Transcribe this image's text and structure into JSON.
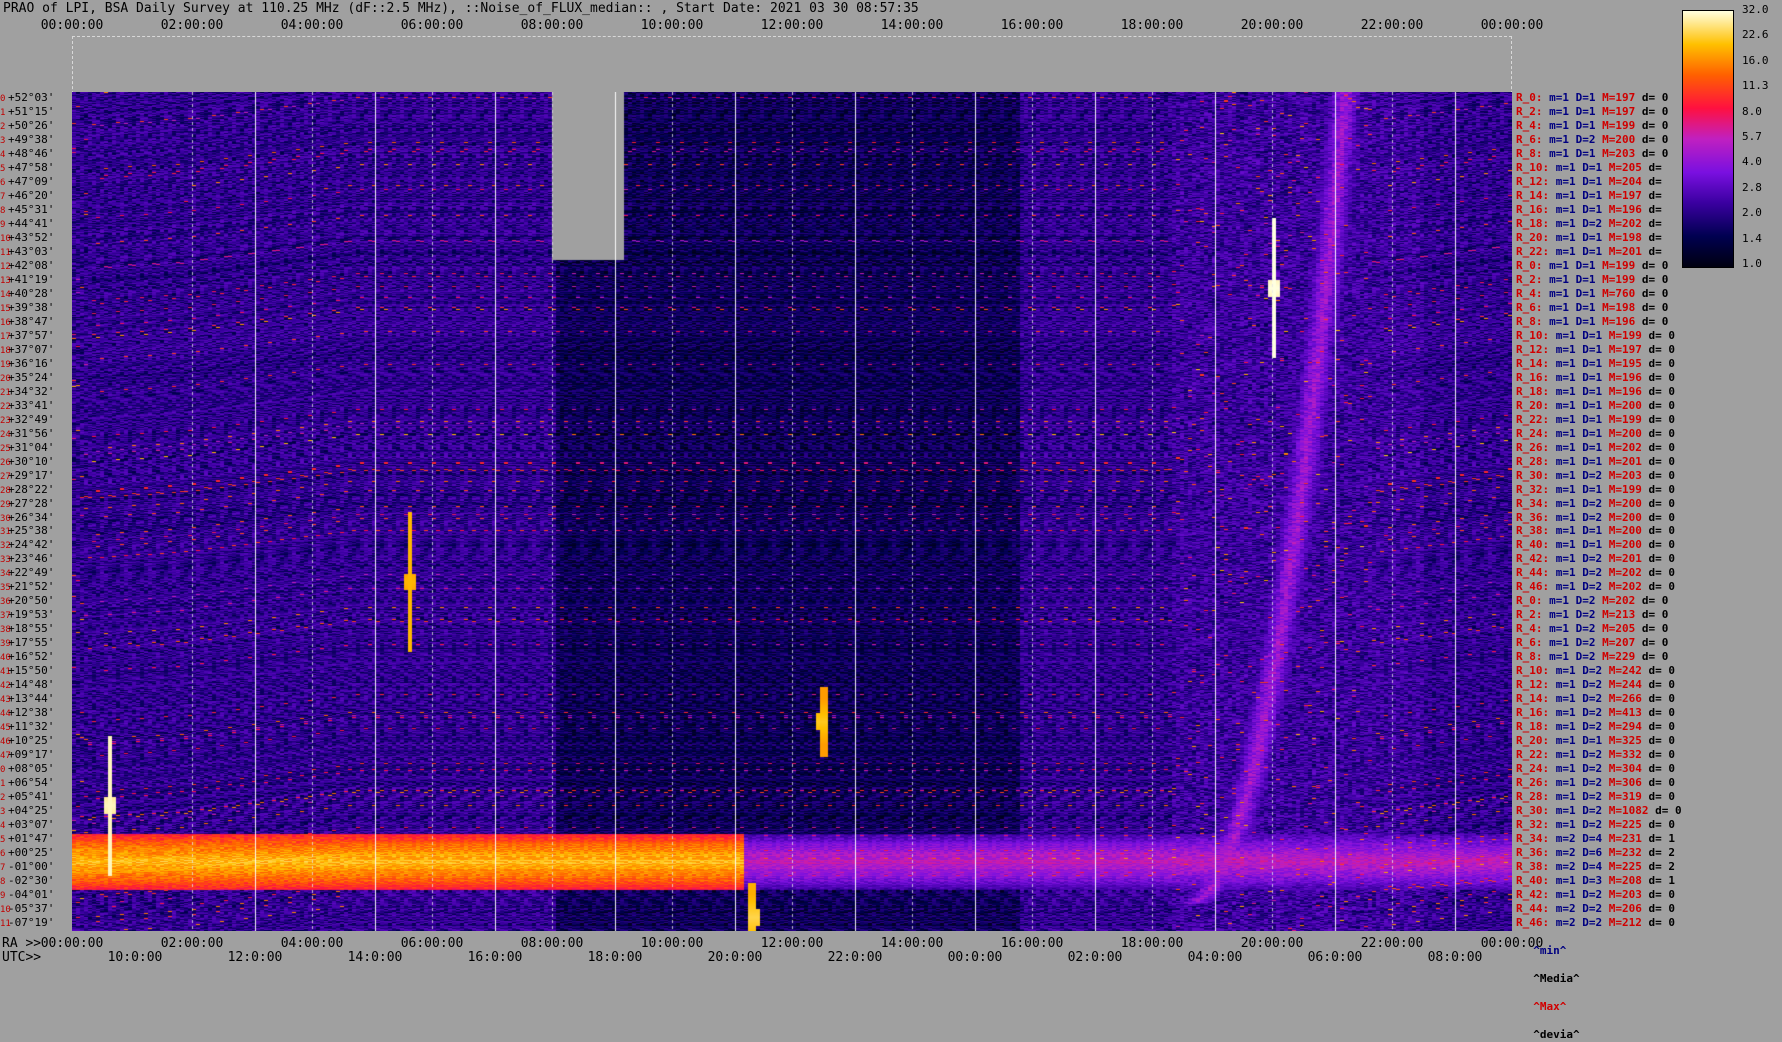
{
  "title": "PRAO of LPI, BSA Daily Survey at 110.25 MHz (dF::2.5 MHz), ::Noise_of_FLUX_median:: , Start Date: 2021 03 30 08:57:35",
  "axes": {
    "top_ticks": [
      "00:00:00",
      "02:00:00",
      "04:00:00",
      "06:00:00",
      "08:00:00",
      "10:00:00",
      "12:00:00",
      "14:00:00",
      "16:00:00",
      "18:00:00",
      "20:00:00",
      "22:00:00",
      "00:00:00"
    ],
    "ra_prefix": "RA >>",
    "ra_ticks": [
      "00:00:00",
      "02:00:00",
      "04:00:00",
      "06:00:00",
      "08:00:00",
      "10:00:00",
      "12:00:00",
      "14:00:00",
      "16:00:00",
      "18:00:00",
      "20:00:00",
      "22:00:00",
      "00:00:00"
    ],
    "utc_prefix": "UTC>>",
    "utc_ticks": [
      "10:0:00",
      "12:0:00",
      "14:0:00",
      "16:0:00",
      "18:0:00",
      "20:0:00",
      "22:0:00",
      "00:0:00",
      "02:0:00",
      "04:0:00",
      "06:0:00",
      "08:0:00"
    ]
  },
  "colorbar": {
    "labels": [
      "32.0",
      "22.6",
      "16.0",
      "11.3",
      "8.0",
      "5.7",
      "4.0",
      "2.8",
      "2.0",
      "1.4",
      "1.0"
    ],
    "colors": [
      "#000010",
      "#000050",
      "#3a00a0",
      "#7a10e0",
      "#c020c0",
      "#ff1040",
      "#ff6000",
      "#ffc000",
      "#ffffe0"
    ]
  },
  "chart_data": {
    "type": "heatmap",
    "title": "PRAO of LPI, BSA Daily Survey at 110.25 MHz (dF::2.5 MHz), ::Noise_of_FLUX_median:: , Start Date: 2021 03 30 08:57:35",
    "x_range_hours": [
      0,
      24
    ],
    "color_scale": [
      1.0,
      32.0
    ],
    "declinations": [
      "+52°03'",
      "+51°15'",
      "+50°26'",
      "+49°38'",
      "+48°46'",
      "+47°58'",
      "+47°09'",
      "+46°20'",
      "+45°31'",
      "+44°41'",
      "+43°52'",
      "+43°03'",
      "+42°08'",
      "+41°19'",
      "+40°28'",
      "+39°38'",
      "+38°47'",
      "+37°57'",
      "+37°07'",
      "+36°16'",
      "+35°24'",
      "+34°32'",
      "+33°41'",
      "+32°49'",
      "+31°56'",
      "+31°04'",
      "+30°10'",
      "+29°17'",
      "+28°22'",
      "+27°28'",
      "+26°34'",
      "+25°38'",
      "+24°42'",
      "+23°46'",
      "+22°49'",
      "+21°52'",
      "+20°50'",
      "+19°53'",
      "+18°55'",
      "+17°55'",
      "+16°52'",
      "+15°50'",
      "+14°48'",
      "+13°44'",
      "+12°38'",
      "+11°32'",
      "+10°25'",
      "+09°17'",
      "+08°05'",
      "+06°54'",
      "+05°41'",
      "+04°25'",
      "+03°07'",
      "+01°47'",
      "+00°25'",
      "-01°00'",
      "-02°30'",
      "-04°01'",
      "-05°37'",
      "-07°19'"
    ],
    "row_index": [
      "0",
      "1",
      "2",
      "3",
      "4",
      "5",
      "6",
      "7",
      "8",
      "9",
      "10",
      "11",
      "12",
      "13",
      "14",
      "15",
      "16",
      "17",
      "18",
      "19",
      "20",
      "21",
      "22",
      "23",
      "24",
      "25",
      "26",
      "27",
      "28",
      "29",
      "30",
      "31",
      "32",
      "33",
      "34",
      "35",
      "36",
      "37",
      "38",
      "39",
      "40",
      "41",
      "42",
      "43",
      "44",
      "45",
      "46",
      "47",
      "0",
      "1",
      "2",
      "3",
      "4",
      "5",
      "6",
      "7",
      "8",
      "9",
      "10",
      "11"
    ],
    "row_stats": [
      {
        "r": "R_0:",
        "m": "m=1",
        "d": "D=1",
        "mx": "M=197",
        "dv": "d= 0"
      },
      {
        "r": "R_2:",
        "m": "m=1",
        "d": "D=1",
        "mx": "M=197",
        "dv": "d= 0"
      },
      {
        "r": "R_4:",
        "m": "m=1",
        "d": "D=1",
        "mx": "M=199",
        "dv": "d= 0"
      },
      {
        "r": "R_6:",
        "m": "m=1",
        "d": "D=2",
        "mx": "M=200",
        "dv": "d= 0"
      },
      {
        "r": "R_8:",
        "m": "m=1",
        "d": "D=1",
        "mx": "M=203",
        "dv": "d= 0"
      },
      {
        "r": "R_10:",
        "m": "m=1",
        "d": "D=1",
        "mx": "M=205",
        "dv": "d="
      },
      {
        "r": "R_12:",
        "m": "m=1",
        "d": "D=1",
        "mx": "M=204",
        "dv": "d="
      },
      {
        "r": "R_14:",
        "m": "m=1",
        "d": "D=1",
        "mx": "M=197",
        "dv": "d="
      },
      {
        "r": "R_16:",
        "m": "m=1",
        "d": "D=1",
        "mx": "M=196",
        "dv": "d="
      },
      {
        "r": "R_18:",
        "m": "m=1",
        "d": "D=2",
        "mx": "M=202",
        "dv": "d="
      },
      {
        "r": "R_20:",
        "m": "m=1",
        "d": "D=1",
        "mx": "M=198",
        "dv": "d="
      },
      {
        "r": "R_22:",
        "m": "m=1",
        "d": "D=1",
        "mx": "M=201",
        "dv": "d="
      },
      {
        "r": "R_0:",
        "m": "m=1",
        "d": "D=1",
        "mx": "M=199",
        "dv": "d= 0"
      },
      {
        "r": "R_2:",
        "m": "m=1",
        "d": "D=1",
        "mx": "M=199",
        "dv": "d= 0"
      },
      {
        "r": "R_4:",
        "m": "m=1",
        "d": "D=1",
        "mx": "M=760",
        "dv": "d= 0"
      },
      {
        "r": "R_6:",
        "m": "m=1",
        "d": "D=1",
        "mx": "M=198",
        "dv": "d= 0"
      },
      {
        "r": "R_8:",
        "m": "m=1",
        "d": "D=1",
        "mx": "M=196",
        "dv": "d= 0"
      },
      {
        "r": "R_10:",
        "m": "m=1",
        "d": "D=1",
        "mx": "M=199",
        "dv": "d= 0"
      },
      {
        "r": "R_12:",
        "m": "m=1",
        "d": "D=1",
        "mx": "M=197",
        "dv": "d= 0"
      },
      {
        "r": "R_14:",
        "m": "m=1",
        "d": "D=1",
        "mx": "M=195",
        "dv": "d= 0"
      },
      {
        "r": "R_16:",
        "m": "m=1",
        "d": "D=1",
        "mx": "M=196",
        "dv": "d= 0"
      },
      {
        "r": "R_18:",
        "m": "m=1",
        "d": "D=1",
        "mx": "M=196",
        "dv": "d= 0"
      },
      {
        "r": "R_20:",
        "m": "m=1",
        "d": "D=1",
        "mx": "M=200",
        "dv": "d= 0"
      },
      {
        "r": "R_22:",
        "m": "m=1",
        "d": "D=1",
        "mx": "M=199",
        "dv": "d= 0"
      },
      {
        "r": "R_24:",
        "m": "m=1",
        "d": "D=1",
        "mx": "M=200",
        "dv": "d= 0"
      },
      {
        "r": "R_26:",
        "m": "m=1",
        "d": "D=1",
        "mx": "M=202",
        "dv": "d= 0"
      },
      {
        "r": "R_28:",
        "m": "m=1",
        "d": "D=1",
        "mx": "M=201",
        "dv": "d= 0"
      },
      {
        "r": "R_30:",
        "m": "m=1",
        "d": "D=2",
        "mx": "M=203",
        "dv": "d= 0"
      },
      {
        "r": "R_32:",
        "m": "m=1",
        "d": "D=1",
        "mx": "M=199",
        "dv": "d= 0"
      },
      {
        "r": "R_34:",
        "m": "m=1",
        "d": "D=2",
        "mx": "M=200",
        "dv": "d= 0"
      },
      {
        "r": "R_36:",
        "m": "m=1",
        "d": "D=2",
        "mx": "M=200",
        "dv": "d= 0"
      },
      {
        "r": "R_38:",
        "m": "m=1",
        "d": "D=1",
        "mx": "M=200",
        "dv": "d= 0"
      },
      {
        "r": "R_40:",
        "m": "m=1",
        "d": "D=1",
        "mx": "M=200",
        "dv": "d= 0"
      },
      {
        "r": "R_42:",
        "m": "m=1",
        "d": "D=2",
        "mx": "M=201",
        "dv": "d= 0"
      },
      {
        "r": "R_44:",
        "m": "m=1",
        "d": "D=2",
        "mx": "M=202",
        "dv": "d= 0"
      },
      {
        "r": "R_46:",
        "m": "m=1",
        "d": "D=2",
        "mx": "M=202",
        "dv": "d= 0"
      },
      {
        "r": "R_0:",
        "m": "m=1",
        "d": "D=2",
        "mx": "M=202",
        "dv": "d= 0"
      },
      {
        "r": "R_2:",
        "m": "m=1",
        "d": "D=2",
        "mx": "M=213",
        "dv": "d= 0"
      },
      {
        "r": "R_4:",
        "m": "m=1",
        "d": "D=2",
        "mx": "M=205",
        "dv": "d= 0"
      },
      {
        "r": "R_6:",
        "m": "m=1",
        "d": "D=2",
        "mx": "M=207",
        "dv": "d= 0"
      },
      {
        "r": "R_8:",
        "m": "m=1",
        "d": "D=2",
        "mx": "M=229",
        "dv": "d= 0"
      },
      {
        "r": "R_10:",
        "m": "m=1",
        "d": "D=2",
        "mx": "M=242",
        "dv": "d= 0"
      },
      {
        "r": "R_12:",
        "m": "m=1",
        "d": "D=2",
        "mx": "M=244",
        "dv": "d= 0"
      },
      {
        "r": "R_14:",
        "m": "m=1",
        "d": "D=2",
        "mx": "M=266",
        "dv": "d= 0"
      },
      {
        "r": "R_16:",
        "m": "m=1",
        "d": "D=2",
        "mx": "M=413",
        "dv": "d= 0"
      },
      {
        "r": "R_18:",
        "m": "m=1",
        "d": "D=2",
        "mx": "M=294",
        "dv": "d= 0"
      },
      {
        "r": "R_20:",
        "m": "m=1",
        "d": "D=1",
        "mx": "M=325",
        "dv": "d= 0"
      },
      {
        "r": "R_22:",
        "m": "m=1",
        "d": "D=2",
        "mx": "M=332",
        "dv": "d= 0"
      },
      {
        "r": "R_24:",
        "m": "m=1",
        "d": "D=2",
        "mx": "M=304",
        "dv": "d= 0"
      },
      {
        "r": "R_26:",
        "m": "m=1",
        "d": "D=2",
        "mx": "M=306",
        "dv": "d= 0"
      },
      {
        "r": "R_28:",
        "m": "m=1",
        "d": "D=2",
        "mx": "M=319",
        "dv": "d= 0"
      },
      {
        "r": "R_30:",
        "m": "m=1",
        "d": "D=2",
        "mx": "M=1082",
        "dv": "d= 0"
      },
      {
        "r": "R_32:",
        "m": "m=1",
        "d": "D=2",
        "mx": "M=225",
        "dv": "d= 0"
      },
      {
        "r": "R_34:",
        "m": "m=2",
        "d": "D=4",
        "mx": "M=231",
        "dv": "d= 1"
      },
      {
        "r": "R_36:",
        "m": "m=2",
        "d": "D=6",
        "mx": "M=232",
        "dv": "d= 2"
      },
      {
        "r": "R_38:",
        "m": "m=2",
        "d": "D=4",
        "mx": "M=225",
        "dv": "d= 2"
      },
      {
        "r": "R_40:",
        "m": "m=1",
        "d": "D=3",
        "mx": "M=208",
        "dv": "d= 1"
      },
      {
        "r": "R_42:",
        "m": "m=1",
        "d": "D=2",
        "mx": "M=203",
        "dv": "d= 0"
      },
      {
        "r": "R_44:",
        "m": "m=2",
        "d": "D=2",
        "mx": "M=206",
        "dv": "d= 0"
      },
      {
        "r": "R_46:",
        "m": "m=2",
        "d": "D=2",
        "mx": "M=212",
        "dv": "d= 0"
      }
    ],
    "legend": {
      "min": "^min^",
      "median": "^Media^",
      "max": "^Max^",
      "dev": "^devia^"
    },
    "gap_region": {
      "x_hours": [
        8.0,
        9.2
      ],
      "rows": [
        0,
        12
      ]
    },
    "features": [
      {
        "type": "band",
        "rows": [
          53,
          57
        ],
        "x_hours": [
          0,
          11.2
        ],
        "level": 22
      },
      {
        "type": "band",
        "rows": [
          53,
          57
        ],
        "x_hours": [
          11.2,
          24
        ],
        "level": 6
      },
      {
        "type": "source",
        "row": 14,
        "x_hour": 20.0,
        "level": 32
      },
      {
        "type": "source",
        "row": 51,
        "x_hour": 0.6,
        "level": 30
      },
      {
        "type": "source",
        "row": 45,
        "x_hour": 12.5,
        "level": 22
      },
      {
        "type": "source",
        "row": 35,
        "x_hour": 5.6,
        "level": 20
      },
      {
        "type": "source",
        "row": 59,
        "x_hour": 11.3,
        "level": 24
      },
      {
        "type": "arc",
        "from": {
          "row": 58,
          "x_hour": 18.6
        },
        "to": {
          "row": 0,
          "x_hour": 21.2
        },
        "level": 5
      }
    ]
  }
}
